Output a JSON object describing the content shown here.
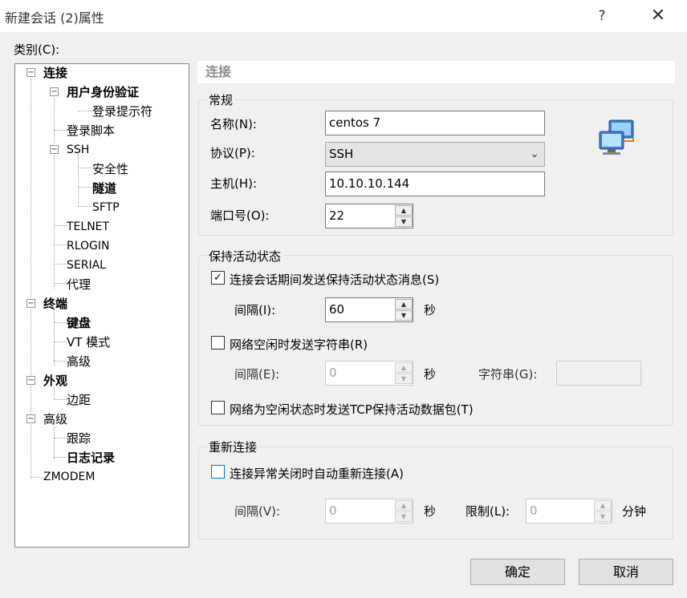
{
  "window": {
    "title": "新建会话 (2)属性",
    "help": "?",
    "close": "✕"
  },
  "category_label": "类别(C):",
  "tree": {
    "connection": "连接",
    "user_auth": "用户身份验证",
    "login_prompt": "登录提示符",
    "login_script": "登录脚本",
    "ssh": "SSH",
    "security": "安全性",
    "tunnel": "隧道",
    "sftp": "SFTP",
    "telnet": "TELNET",
    "rlogin": "RLOGIN",
    "serial": "SERIAL",
    "proxy": "代理",
    "terminal": "终端",
    "keyboard": "键盘",
    "vt_mode": "VT 模式",
    "terminal_advanced": "高级",
    "appearance": "外观",
    "margin": "边距",
    "advanced": "高级",
    "trace": "跟踪",
    "logging": "日志记录",
    "zmodem": "ZMODEM",
    "expanded_symbol": "−"
  },
  "panel": {
    "header": "连接",
    "general": {
      "legend": "常规",
      "name_label": "名称(N):",
      "name_value": "centos 7",
      "protocol_label": "协议(P):",
      "protocol_value": "SSH",
      "host_label": "主机(H):",
      "host_value": "10.10.10.144",
      "port_label": "端口号(O):",
      "port_value": "22"
    },
    "keepalive": {
      "legend": "保持活动状态",
      "send_msg_label": "连接会话期间发送保持活动状态消息(S)",
      "send_msg_checked": true,
      "interval_label": "间隔(I):",
      "interval_value": "60",
      "interval_unit": "秒",
      "send_string_label": "网络空闲时发送字符串(R)",
      "send_string_checked": false,
      "interval2_label": "间隔(E):",
      "interval2_value": "0",
      "interval2_unit": "秒",
      "string_label": "字符串(G):",
      "string_value": "",
      "tcp_label": "网络为空闲状态时发送TCP保持活动数据包(T)",
      "tcp_checked": false
    },
    "reconnect": {
      "legend": "重新连接",
      "auto_label": "连接异常关闭时自动重新连接(A)",
      "auto_checked": false,
      "interval_label": "间隔(V):",
      "interval_value": "0",
      "interval_unit": "秒",
      "limit_label": "限制(L):",
      "limit_value": "0",
      "limit_unit": "分钟"
    }
  },
  "buttons": {
    "ok": "确定",
    "cancel": "取消"
  },
  "glyphs": {
    "check": "✓",
    "up": "▲",
    "down": "▼",
    "dropdown": "⌄"
  },
  "colors": {
    "focus_blue": "#0078d7",
    "header_gray": "#8c8c8c"
  }
}
